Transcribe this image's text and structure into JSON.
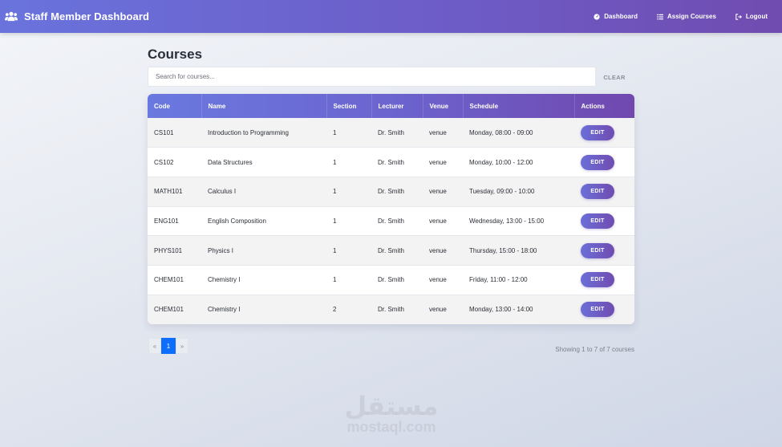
{
  "navbar": {
    "brand_title": "Staff Member Dashboard",
    "links": [
      {
        "label": "Dashboard",
        "icon": "dashboard-icon"
      },
      {
        "label": "Assign Courses",
        "icon": "list-icon"
      },
      {
        "label": "Logout",
        "icon": "logout-icon"
      }
    ]
  },
  "courses": {
    "title": "Courses",
    "search_placeholder": "Search for courses...",
    "search_value": "",
    "clear_label": "CLEAR",
    "columns": [
      "Code",
      "Name",
      "Section",
      "Lecturer",
      "Venue",
      "Schedule",
      "Actions"
    ],
    "rows": [
      {
        "code": "CS101",
        "name": "Introduction to Programming",
        "section": "1",
        "lecturer": "Dr. Smith",
        "venue": "venue",
        "schedule": "Monday, 08:00 - 09:00",
        "action": "EDIT"
      },
      {
        "code": "CS102",
        "name": "Data Structures",
        "section": "1",
        "lecturer": "Dr. Smith",
        "venue": "venue",
        "schedule": "Monday, 10:00 - 12:00",
        "action": "EDIT"
      },
      {
        "code": "MATH101",
        "name": "Calculus I",
        "section": "1",
        "lecturer": "Dr. Smith",
        "venue": "venue",
        "schedule": "Tuesday, 09:00 - 10:00",
        "action": "EDIT"
      },
      {
        "code": "ENG101",
        "name": "English Composition",
        "section": "1",
        "lecturer": "Dr. Smith",
        "venue": "venue",
        "schedule": "Wednesday, 13:00 - 15:00",
        "action": "EDIT"
      },
      {
        "code": "PHYS101",
        "name": "Physics I",
        "section": "1",
        "lecturer": "Dr. Smith",
        "venue": "venue",
        "schedule": "Thursday, 15:00 - 18:00",
        "action": "EDIT"
      },
      {
        "code": "CHEM101",
        "name": "Chemistry I",
        "section": "1",
        "lecturer": "Dr. Smith",
        "venue": "venue",
        "schedule": "Friday, 11:00 - 12:00",
        "action": "EDIT"
      },
      {
        "code": "CHEM101",
        "name": "Chemistry I",
        "section": "2",
        "lecturer": "Dr. Smith",
        "venue": "venue",
        "schedule": "Monday, 13:00 - 14:00",
        "action": "EDIT"
      }
    ]
  },
  "pagination": {
    "prev": "«",
    "current": "1",
    "next": "»",
    "summary": "Showing 1 to 7 of 7 courses"
  },
  "watermark": {
    "arabic": "مستقل",
    "latin": "mostaql.com"
  },
  "colors": {
    "accent_start": "#6a73dc",
    "accent_end": "#704cb0",
    "page_active": "#0d6efd"
  }
}
